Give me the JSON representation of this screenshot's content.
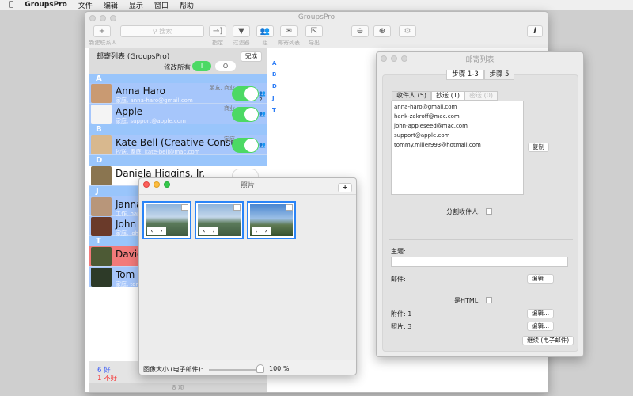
{
  "menubar": {
    "app": "GroupsPro",
    "items": [
      "文件",
      "编辑",
      "显示",
      "窗口",
      "帮助"
    ]
  },
  "main": {
    "title": "GroupsPro",
    "toolbar": {
      "new_contact": "新建联系人",
      "search_placeholder": "搜索",
      "assign": "指定",
      "filter": "过滤器",
      "groups": "组",
      "mailing_list": "邮寄列表",
      "export": "导出"
    },
    "list_title": "邮寄列表 (GroupsPro)",
    "done": "完成",
    "modify_all": "修改所有",
    "on": "I",
    "off": "O",
    "sections": {
      "a": "A",
      "b": "B",
      "d": "D",
      "j": "J",
      "t": "T"
    },
    "contacts": [
      {
        "name": "Anna Haro",
        "sub": "家庭, anna-haro@gmail.com",
        "tags": "朋友, 商业",
        "on": true,
        "count": "2"
      },
      {
        "name": "Apple",
        "sub": "家庭, support@apple.com",
        "tags": "商业",
        "on": true
      },
      {
        "name": "Kate Bell (Creative Consulting)",
        "sub": "抄送, 家庭, kate-bell@mac.com",
        "tags": "家庭",
        "on": true
      },
      {
        "name": "Daniela Higgins, Jr.",
        "sub": "",
        "on": false
      },
      {
        "name": "Janna",
        "sub": "工作, hank...",
        "on": false
      },
      {
        "name": "John Appleseed",
        "sub": "家庭, john...",
        "on": false
      },
      {
        "name": "David",
        "sub": "",
        "bad": true
      },
      {
        "name": "Tom M",
        "sub": "家庭, tom...",
        "on": false
      }
    ],
    "index": [
      "A",
      "B",
      "D",
      "J",
      "T"
    ],
    "good": "6 好",
    "bad": "1 不好",
    "count": "8 项"
  },
  "photos": {
    "title": "照片",
    "add": "+",
    "size_label": "图像大小 (电子邮件):",
    "size_value": "100 %",
    "size_percent": 100
  },
  "mail": {
    "title": "邮寄列表",
    "step1": "步骤 1-3",
    "step5": "步骤 5",
    "tabs": [
      "收件人 (5)",
      "抄送 (1)",
      "密送 (0)"
    ],
    "recipients": [
      "anna-haro@gmail.com",
      "hank-zakroff@mac.com",
      "john-appleseed@mac.com",
      "support@apple.com",
      "tommy.miller993@hotmail.com"
    ],
    "copy": "复制",
    "split": "分割收件人:",
    "subject": "主题:",
    "subject_value": "",
    "message": "邮件:",
    "edit": "编辑...",
    "is_html": "是HTML:",
    "attachments": "附件: 1",
    "photos": "照片: 3",
    "continue": "继续 (电子邮件)"
  }
}
